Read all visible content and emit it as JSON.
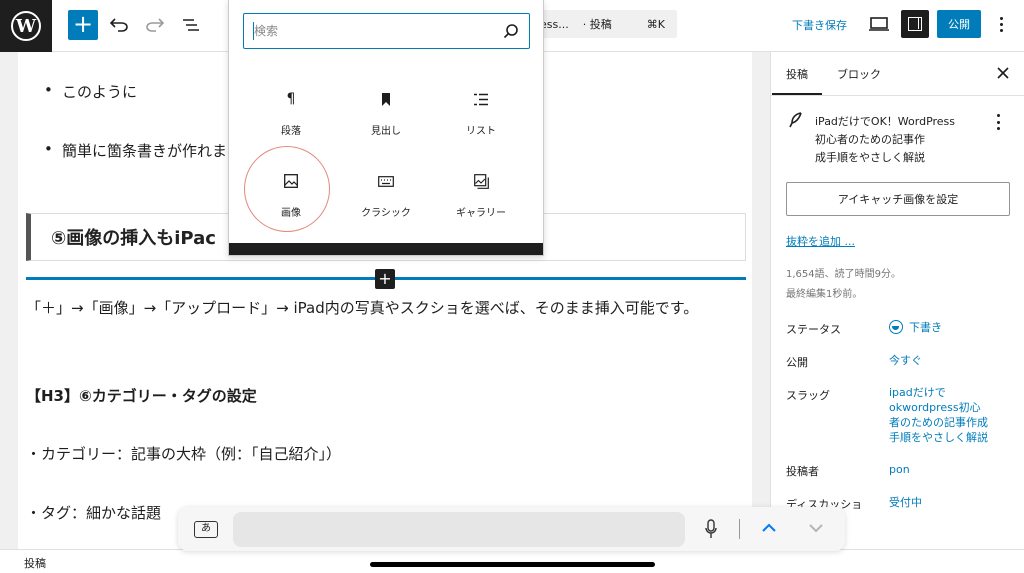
{
  "toolbar": {
    "logo_letter": "W",
    "add_label": "+",
    "doc_title": "ess...",
    "doc_type": "· 投稿",
    "doc_shortcut": "⌘K",
    "save_draft": "下書き保存",
    "publish": "公開"
  },
  "editor": {
    "bullets": [
      "このように",
      "簡単に箇条書きが作れま"
    ],
    "heading": "⑤画像の挿入もiPac",
    "paragraphs": [
      "「＋」→「画像」→「アップロード」→ iPad内の写真やスクショを選べば、そのまま挿入可能です。",
      "【H3】⑥カテゴリー・タグの設定",
      "・カテゴリー：記事の大枠（例：「自己紹介」）",
      "・タグ：細かな話題"
    ]
  },
  "inserter": {
    "search_placeholder": "検索",
    "blocks": [
      {
        "label": "段落",
        "icon": "paragraph-icon"
      },
      {
        "label": "見出し",
        "icon": "heading-bookmark-icon"
      },
      {
        "label": "リスト",
        "icon": "list-icon"
      },
      {
        "label": "画像",
        "icon": "image-icon"
      },
      {
        "label": "クラシック",
        "icon": "keyboard-icon"
      },
      {
        "label": "ギャラリー",
        "icon": "gallery-icon"
      }
    ]
  },
  "sidebar": {
    "tab_post": "投稿",
    "tab_block": "ブロック",
    "post_title_lines": [
      "iPadだけでOK！WordPress",
      "初心者のための記事作",
      "成手順をやさしく解説"
    ],
    "featured_image": "アイキャッチ画像を設定",
    "add_excerpt": "抜粋を追加 ...",
    "word_count": "1,654語、読了時間9分。",
    "last_edited": "最終編集1秒前。",
    "rows": [
      {
        "label": "ステータス",
        "value": "下書き"
      },
      {
        "label": "公開",
        "value": "今すぐ"
      },
      {
        "label": "スラッグ",
        "value_lines": [
          "ipadだけで",
          "okwordpress初心",
          "者のための記事作成",
          "手順をやさしく解説"
        ]
      },
      {
        "label": "投稿者",
        "value": "pon"
      },
      {
        "label": "ディスカッショ",
        "value": "受付中"
      }
    ]
  },
  "footer": {
    "breadcrumb": "投稿"
  },
  "keyboard_bar": {
    "lang_key": "あ"
  },
  "colors": {
    "accent": "#007cba",
    "dark": "#1e1e1e",
    "highlight": "#e08a7a"
  }
}
